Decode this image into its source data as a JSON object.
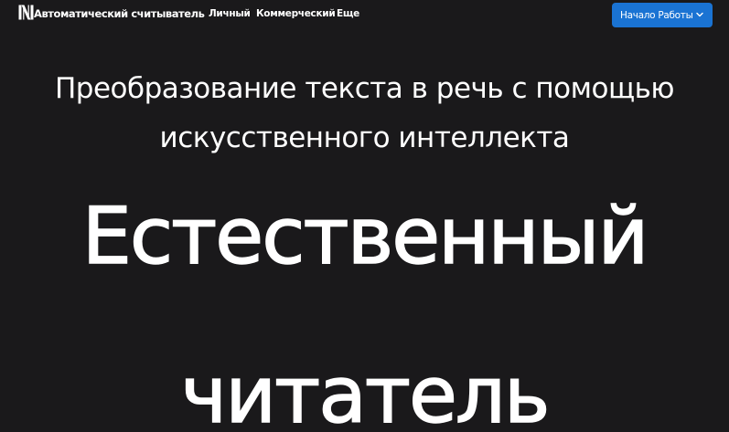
{
  "navbar": {
    "brand": "Автоматический считыватель",
    "links": {
      "personal": "Личный",
      "commercial": "Коммерческий",
      "more": "Еще"
    },
    "start_button": "Начало Работы"
  },
  "hero": {
    "subtitle_line1": "Преобразование текста в речь с помощью",
    "subtitle_line2": "искусственного интеллекта",
    "headline_line1": "Естественный",
    "headline_line2": "читатель"
  },
  "colors": {
    "background": "#1a191b",
    "accent": "#1a73d3",
    "text": "#ffffff"
  },
  "icons": {
    "logo": "n-logo-icon",
    "dropdown": "chevron-down-icon"
  }
}
